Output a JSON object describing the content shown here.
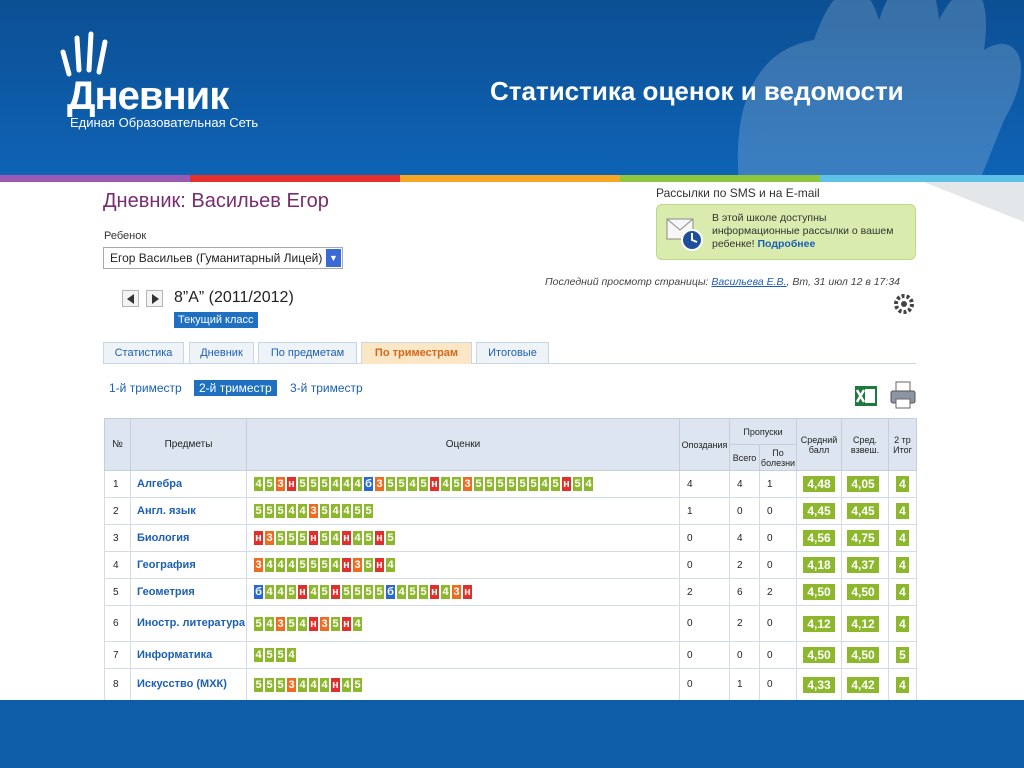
{
  "slide": {
    "logo_text": "Дневник",
    "logo_subtitle": "Единая Образовательная Сеть",
    "title": "Статистика оценок и ведомости"
  },
  "page": {
    "heading": "Дневник: Васильев Егор",
    "child_label": "Ребенок",
    "child_value": "Егор Васильев (Гуманитарный Лицей)",
    "class_name": "8”А” (2011/2012)",
    "current_class_badge": "Текущий класс"
  },
  "sms": {
    "title": "Рассылки по SMS и на E-mail",
    "text": "В этой школе доступны информационные рассылки о вашем ребенке!",
    "link": "Подробнее"
  },
  "last_view": {
    "prefix": "Последний просмотр страницы:",
    "who": "Васильева Е.В.",
    "when": ", Вт, 31 июл 12 в 17:34"
  },
  "tabs": [
    "Статистика",
    "Дневник",
    "По предметам",
    "По триместрам",
    "Итоговые"
  ],
  "active_tab": "По триместрам",
  "trimesters": [
    "1-й триместр",
    "2-й триместр",
    "3-й триместр"
  ],
  "active_trimester": "2-й триместр",
  "colors": {
    "mark_5": "#8db72c",
    "mark_4": "#8db72c",
    "mark_3": "#ed6c1f",
    "mark_n": "#e0302b",
    "mark_b": "#2a6ad0"
  },
  "table": {
    "headers": {
      "num": "№",
      "subject": "Предметы",
      "marks": "Оценки",
      "late": "Опоздания",
      "absences": "Пропуски",
      "abs_total": "Всего",
      "abs_ill": "По болезни",
      "avg": "Средний балл",
      "wavg": "Сред. взвеш.",
      "final": "2 тр Итог"
    },
    "rows": [
      {
        "num": "1",
        "subject": "Алгебра",
        "marks": "4 5 3 н 5 5 5 4 4 4 б 3 5 5 4 5 н 4 5 3 5 5 5 5 5 5 4 5 н 5 4",
        "late": "4",
        "total": "4",
        "ill": "1",
        "avg": "4,48",
        "wavg": "4,05",
        "final": "4"
      },
      {
        "num": "2",
        "subject": "Англ. язык",
        "marks": "5 5 5 4 4 3 5 4 4 5 5",
        "late": "1",
        "total": "0",
        "ill": "0",
        "avg": "4,45",
        "wavg": "4,45",
        "final": "4"
      },
      {
        "num": "3",
        "subject": "Биология",
        "marks": "н 3 5 5 5 н 5 4 н 4 5 н 5",
        "late": "0",
        "total": "4",
        "ill": "0",
        "avg": "4,56",
        "wavg": "4,75",
        "final": "4"
      },
      {
        "num": "4",
        "subject": "География",
        "marks": "3 4 4 4 5 5 5 4 н 3 5 н 4",
        "late": "0",
        "total": "2",
        "ill": "0",
        "avg": "4,18",
        "wavg": "4,37",
        "final": "4"
      },
      {
        "num": "5",
        "subject": "Геометрия",
        "marks": "б 4 4 5 н 4 5 н 5 5 5 5 б 4 5 5 н 4 3 н",
        "late": "2",
        "total": "6",
        "ill": "2",
        "avg": "4,50",
        "wavg": "4,50",
        "final": "4"
      },
      {
        "num": "6",
        "subject": "Иностр. литература",
        "marks": "5 4 3 5 4 н 3 5 н 4",
        "late": "0",
        "total": "2",
        "ill": "0",
        "avg": "4,12",
        "wavg": "4,12",
        "final": "4"
      },
      {
        "num": "7",
        "subject": "Информатика",
        "marks": "4 5 5 4",
        "late": "0",
        "total": "0",
        "ill": "0",
        "avg": "4,50",
        "wavg": "4,50",
        "final": "5"
      },
      {
        "num": "8",
        "subject": "Искусство (МХК)",
        "marks": "5 5 5 3 4 4 4 н 4 5",
        "late": "0",
        "total": "1",
        "ill": "0",
        "avg": "4,33",
        "wavg": "4,42",
        "final": "4"
      }
    ]
  }
}
